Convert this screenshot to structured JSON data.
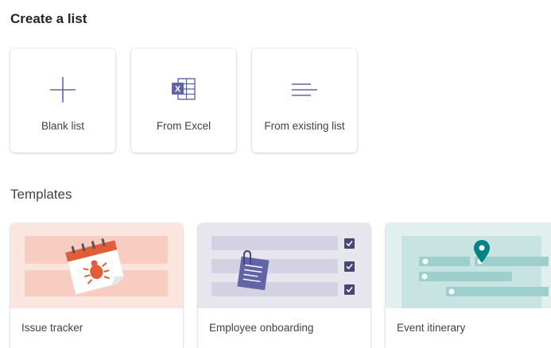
{
  "page": {
    "title": "Create a list"
  },
  "create_options": [
    {
      "label": "Blank list",
      "icon": "plus-icon"
    },
    {
      "label": "From Excel",
      "icon": "excel-icon"
    },
    {
      "label": "From existing list",
      "icon": "list-lines-icon"
    }
  ],
  "templates_section": {
    "title": "Templates"
  },
  "templates": [
    {
      "label": "Issue tracker",
      "art_bg": "#fbe5df"
    },
    {
      "label": "Employee onboarding",
      "art_bg": "#e7e6ee"
    },
    {
      "label": "Event itinerary",
      "art_bg": "#e1f0ef"
    }
  ],
  "colors": {
    "accent": "#5b5fc7",
    "tracker": "#e15c39",
    "onboarding": "#6264a7",
    "itinerary": "#038387"
  }
}
